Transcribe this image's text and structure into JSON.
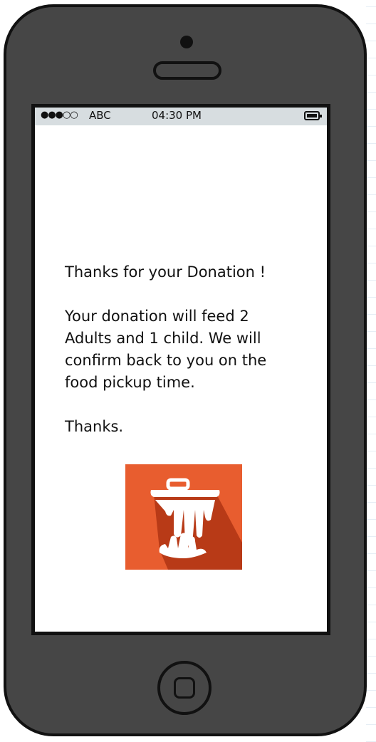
{
  "status_bar": {
    "signal": "●●●○○",
    "carrier": "ABC",
    "time": "04:30 PM",
    "battery_icon": "battery-icon"
  },
  "message": {
    "heading": "Thanks for your Donation !",
    "body": "Your donation will feed 2 Adults and 1 child. We will confirm back to you on the food pickup time.",
    "closing": "Thanks."
  },
  "logo": {
    "icon": "trash-can-hand-icon",
    "background": "#e85d2f",
    "shadow": "#b83a17"
  }
}
